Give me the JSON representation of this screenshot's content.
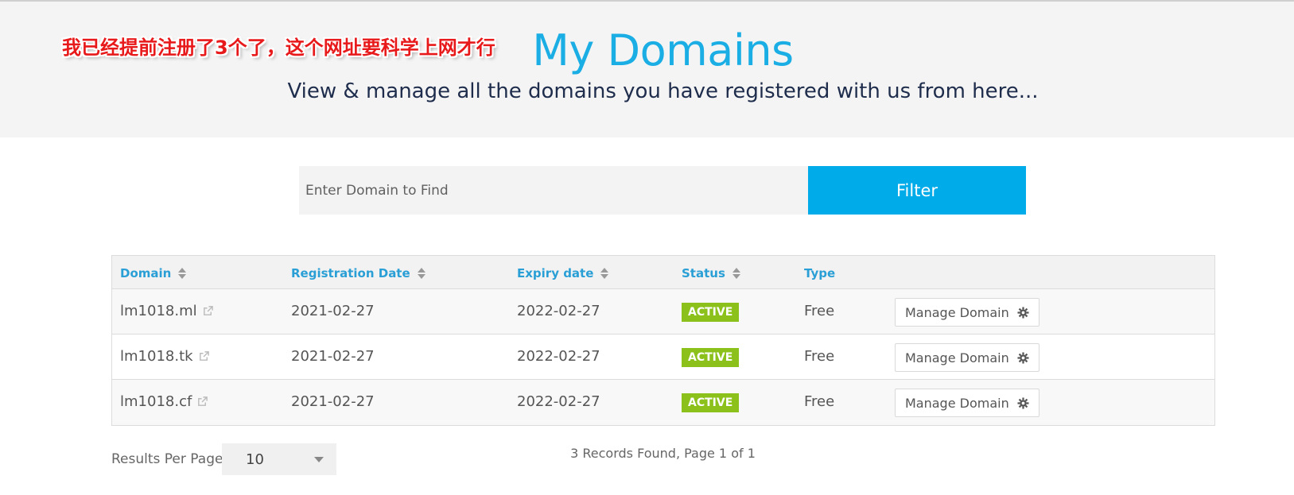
{
  "annotation": "我已经提前注册了3个了，这个网址要科学上网才行",
  "header": {
    "title": "My Domains",
    "subtitle": "View & manage all the domains you have registered with us from here..."
  },
  "search": {
    "placeholder": "Enter Domain to Find",
    "value": "",
    "filter_label": "Filter"
  },
  "table": {
    "columns": [
      "Domain",
      "Registration Date",
      "Expiry date",
      "Status",
      "Type"
    ],
    "rows": [
      {
        "domain": "lm1018.ml",
        "registration_date": "2021-02-27",
        "expiry_date": "2022-02-27",
        "status": "ACTIVE",
        "type": "Free",
        "action": "Manage Domain"
      },
      {
        "domain": "lm1018.tk",
        "registration_date": "2021-02-27",
        "expiry_date": "2022-02-27",
        "status": "ACTIVE",
        "type": "Free",
        "action": "Manage Domain"
      },
      {
        "domain": "lm1018.cf",
        "registration_date": "2021-02-27",
        "expiry_date": "2022-02-27",
        "status": "ACTIVE",
        "type": "Free",
        "action": "Manage Domain"
      }
    ]
  },
  "pagination": {
    "results_per_page_label": "Results Per Page:",
    "results_per_page_value": "10",
    "records_text": "3 Records Found, Page 1 of 1"
  },
  "colors": {
    "accent": "#00abe9",
    "title": "#1aaee5",
    "status_active": "#8cc11c",
    "annotation": "#e8191a"
  },
  "icons": {
    "sort": "sort-icon",
    "external_link": "external-link-icon",
    "gear": "gear-icon",
    "dropdown": "chevron-down-icon"
  }
}
